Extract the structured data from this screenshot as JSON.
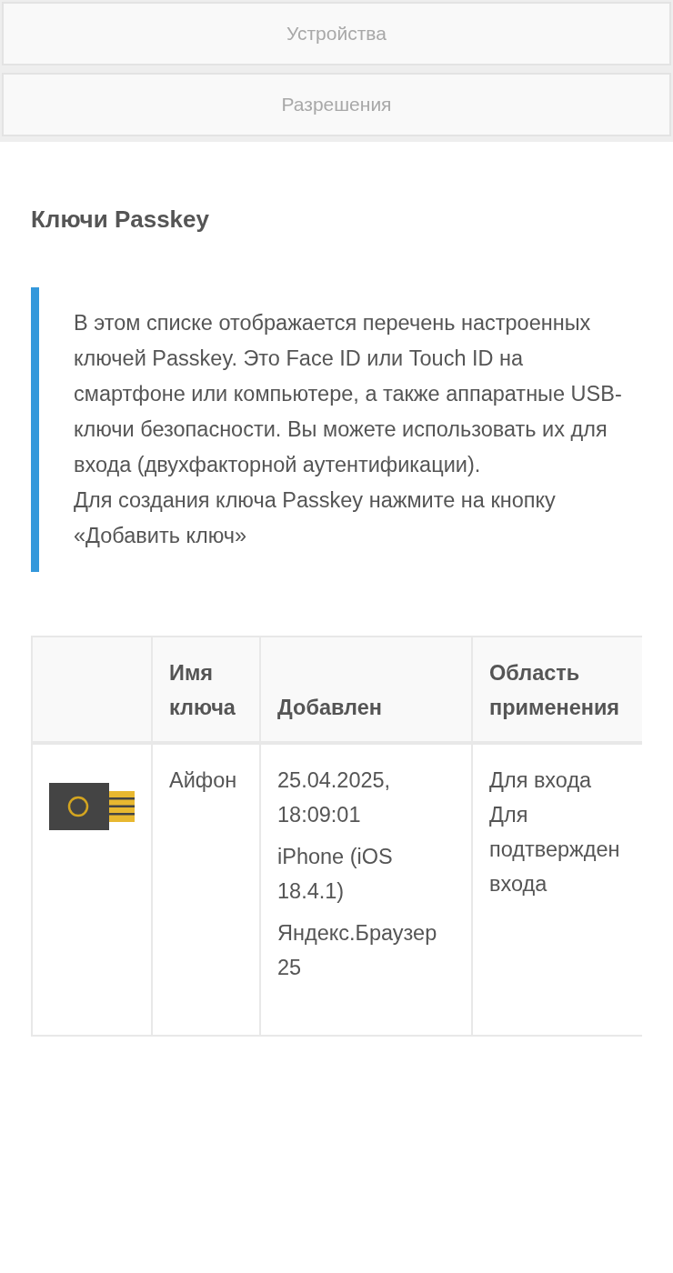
{
  "tabs": [
    {
      "label": "Устройства"
    },
    {
      "label": "Разрешения"
    }
  ],
  "section_title": "Ключи Passkey",
  "note": [
    "В этом списке отображается перечень настроенных ключей Passkey. Это Face ID или Touch ID на смартфоне или компьютере, а также аппаратные USB-ключи безопасности. Вы можете использовать их для входа (двухфакторной аутентификации).",
    "Для создания ключа Passkey нажмите на кнопку «Добавить ключ»"
  ],
  "table": {
    "columns": [
      "Имя ключа",
      "Добавлен",
      "Область применения"
    ],
    "rows": [
      {
        "name": "Айфон",
        "added": [
          "25.04.2025, 18:09:01",
          "iPhone (iOS 18.4.1)",
          "Яндекс.Браузер 25"
        ],
        "scopes": [
          "Для входа",
          "Для подтвержден входа"
        ]
      }
    ]
  }
}
